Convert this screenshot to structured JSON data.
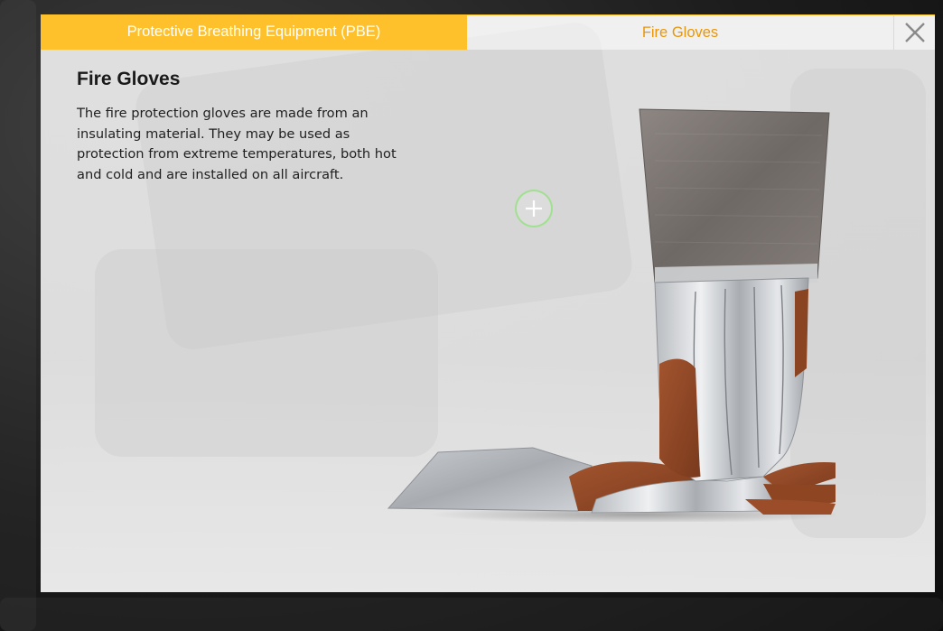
{
  "tabs": [
    {
      "label": "Protective Breathing Equipment (PBE)",
      "active": false
    },
    {
      "label": "Fire Gloves",
      "active": true
    }
  ],
  "content": {
    "title": "Fire Gloves",
    "description": "The fire protection gloves are made from an insulating material. They may be used as protection from extreme temperatures, both hot and cold and are installed on all aircraft."
  },
  "icons": {
    "close": "close-icon",
    "hotspot": "plus-icon"
  },
  "colors": {
    "accent": "#FEC12B",
    "active_tab_text": "#E8960C",
    "hotspot_ring": "#96E182"
  }
}
